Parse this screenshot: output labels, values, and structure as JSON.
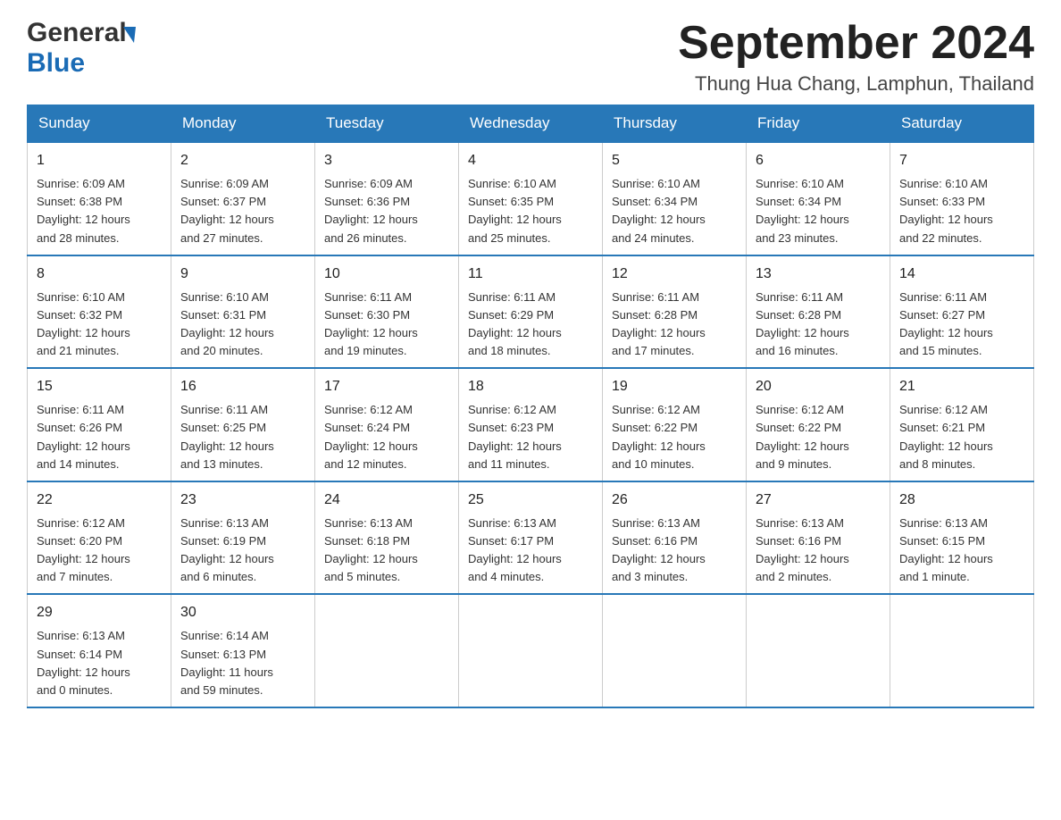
{
  "header": {
    "logo_word1": "General",
    "logo_word2": "Blue",
    "month_title": "September 2024",
    "location": "Thung Hua Chang, Lamphun, Thailand"
  },
  "weekdays": [
    "Sunday",
    "Monday",
    "Tuesday",
    "Wednesday",
    "Thursday",
    "Friday",
    "Saturday"
  ],
  "weeks": [
    [
      {
        "day": "1",
        "sunrise": "6:09 AM",
        "sunset": "6:38 PM",
        "daylight": "12 hours and 28 minutes."
      },
      {
        "day": "2",
        "sunrise": "6:09 AM",
        "sunset": "6:37 PM",
        "daylight": "12 hours and 27 minutes."
      },
      {
        "day": "3",
        "sunrise": "6:09 AM",
        "sunset": "6:36 PM",
        "daylight": "12 hours and 26 minutes."
      },
      {
        "day": "4",
        "sunrise": "6:10 AM",
        "sunset": "6:35 PM",
        "daylight": "12 hours and 25 minutes."
      },
      {
        "day": "5",
        "sunrise": "6:10 AM",
        "sunset": "6:34 PM",
        "daylight": "12 hours and 24 minutes."
      },
      {
        "day": "6",
        "sunrise": "6:10 AM",
        "sunset": "6:34 PM",
        "daylight": "12 hours and 23 minutes."
      },
      {
        "day": "7",
        "sunrise": "6:10 AM",
        "sunset": "6:33 PM",
        "daylight": "12 hours and 22 minutes."
      }
    ],
    [
      {
        "day": "8",
        "sunrise": "6:10 AM",
        "sunset": "6:32 PM",
        "daylight": "12 hours and 21 minutes."
      },
      {
        "day": "9",
        "sunrise": "6:10 AM",
        "sunset": "6:31 PM",
        "daylight": "12 hours and 20 minutes."
      },
      {
        "day": "10",
        "sunrise": "6:11 AM",
        "sunset": "6:30 PM",
        "daylight": "12 hours and 19 minutes."
      },
      {
        "day": "11",
        "sunrise": "6:11 AM",
        "sunset": "6:29 PM",
        "daylight": "12 hours and 18 minutes."
      },
      {
        "day": "12",
        "sunrise": "6:11 AM",
        "sunset": "6:28 PM",
        "daylight": "12 hours and 17 minutes."
      },
      {
        "day": "13",
        "sunrise": "6:11 AM",
        "sunset": "6:28 PM",
        "daylight": "12 hours and 16 minutes."
      },
      {
        "day": "14",
        "sunrise": "6:11 AM",
        "sunset": "6:27 PM",
        "daylight": "12 hours and 15 minutes."
      }
    ],
    [
      {
        "day": "15",
        "sunrise": "6:11 AM",
        "sunset": "6:26 PM",
        "daylight": "12 hours and 14 minutes."
      },
      {
        "day": "16",
        "sunrise": "6:11 AM",
        "sunset": "6:25 PM",
        "daylight": "12 hours and 13 minutes."
      },
      {
        "day": "17",
        "sunrise": "6:12 AM",
        "sunset": "6:24 PM",
        "daylight": "12 hours and 12 minutes."
      },
      {
        "day": "18",
        "sunrise": "6:12 AM",
        "sunset": "6:23 PM",
        "daylight": "12 hours and 11 minutes."
      },
      {
        "day": "19",
        "sunrise": "6:12 AM",
        "sunset": "6:22 PM",
        "daylight": "12 hours and 10 minutes."
      },
      {
        "day": "20",
        "sunrise": "6:12 AM",
        "sunset": "6:22 PM",
        "daylight": "12 hours and 9 minutes."
      },
      {
        "day": "21",
        "sunrise": "6:12 AM",
        "sunset": "6:21 PM",
        "daylight": "12 hours and 8 minutes."
      }
    ],
    [
      {
        "day": "22",
        "sunrise": "6:12 AM",
        "sunset": "6:20 PM",
        "daylight": "12 hours and 7 minutes."
      },
      {
        "day": "23",
        "sunrise": "6:13 AM",
        "sunset": "6:19 PM",
        "daylight": "12 hours and 6 minutes."
      },
      {
        "day": "24",
        "sunrise": "6:13 AM",
        "sunset": "6:18 PM",
        "daylight": "12 hours and 5 minutes."
      },
      {
        "day": "25",
        "sunrise": "6:13 AM",
        "sunset": "6:17 PM",
        "daylight": "12 hours and 4 minutes."
      },
      {
        "day": "26",
        "sunrise": "6:13 AM",
        "sunset": "6:16 PM",
        "daylight": "12 hours and 3 minutes."
      },
      {
        "day": "27",
        "sunrise": "6:13 AM",
        "sunset": "6:16 PM",
        "daylight": "12 hours and 2 minutes."
      },
      {
        "day": "28",
        "sunrise": "6:13 AM",
        "sunset": "6:15 PM",
        "daylight": "12 hours and 1 minute."
      }
    ],
    [
      {
        "day": "29",
        "sunrise": "6:13 AM",
        "sunset": "6:14 PM",
        "daylight": "12 hours and 0 minutes."
      },
      {
        "day": "30",
        "sunrise": "6:14 AM",
        "sunset": "6:13 PM",
        "daylight": "11 hours and 59 minutes."
      },
      null,
      null,
      null,
      null,
      null
    ]
  ],
  "labels": {
    "sunrise": "Sunrise:",
    "sunset": "Sunset:",
    "daylight": "Daylight:"
  }
}
